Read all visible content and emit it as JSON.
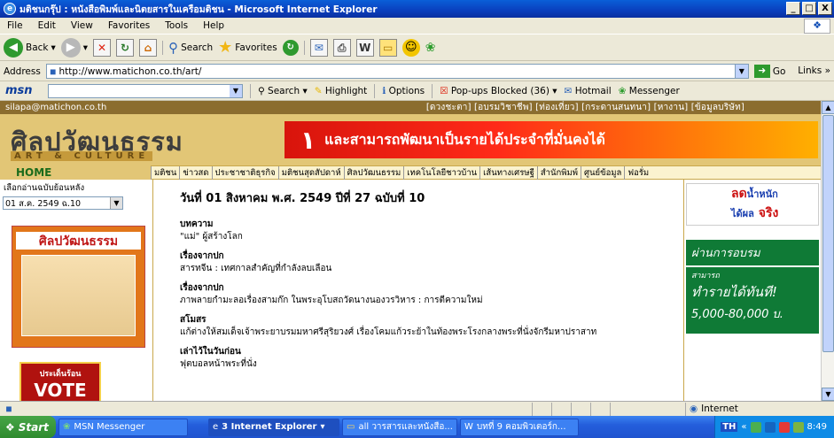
{
  "window": {
    "title": "มติชนกรุ๊ป : หนังสือพิมพ์และนิตยสารในเครือมติชน - Microsoft Internet Explorer",
    "controls": [
      "_",
      "ð",
      "X"
    ]
  },
  "menu": [
    "File",
    "Edit",
    "View",
    "Favorites",
    "Tools",
    "Help"
  ],
  "toolbar": {
    "back": "Back",
    "search": "Search",
    "favorites": "Favorites"
  },
  "address": {
    "label": "Address",
    "url": "http://www.matichon.co.th/art/",
    "go": "Go",
    "links": "Links"
  },
  "msnbar": {
    "brand": "msn",
    "search": "Search",
    "highlight": "Highlight",
    "options": "Options",
    "popups": "Pop-ups Blocked (36)",
    "hotmail": "Hotmail",
    "messenger": "Messenger"
  },
  "site": {
    "email": "silapa@matichon.co.th",
    "toplinks": "[ดวงชะตา] [อบรมวิชาชีพ] [ท่องเที่ยว] [กระดานสนทนา] [หางาน] [ข้อมูลบริษัท]",
    "logo": "ศิลปวัฒนธรรม",
    "logo_sub": "ART & CULTURE",
    "ad_text": "และสามารถพัฒนาเป็นรายได้ประจำที่มั่นคงได้",
    "home": "HOME",
    "nav": [
      "มติชน",
      "ข่าวสด",
      "ประชาชาติธุรกิจ",
      "มติชนสุดสัปดาห์",
      "ศิลปวัฒนธรรม",
      "เทคโนโลยีชาวบ้าน",
      "เส้นทางเศรษฐี",
      "สำนักพิมพ์",
      "ศูนย์ข้อมูล",
      "ฟอรั่ม"
    ],
    "back_issues_label": "เลือกอ่านฉบับย้อนหลัง",
    "issue_selected": "01 ส.ค. 2549 ฉ.10",
    "cover_title": "ศิลปวัฒนธรรม",
    "vote_top": "ประเด็นร้อน",
    "vote": "VOTE",
    "date": "วันที่ 01 สิงหาคม พ.ศ. 2549 ปีที่ 27 ฉบับที่ 10",
    "sections": [
      {
        "heading": "บทความ",
        "text": "\"แม่\" ผู้สร้างโลก"
      },
      {
        "heading": "เรื่องจากปก",
        "text": "สารทจีน : เทศกาลสำคัญที่กำลังลบเลือน"
      },
      {
        "heading": "เรื่องจากปก",
        "text": "ภาพลายกำมะลอเรื่องสามก๊ก ในพระอุโบสถวัดนางนองวรวิหาร : การตีความใหม่"
      },
      {
        "heading": "สโมสร",
        "text": "แก้ต่างให้สมเด็จเจ้าพระยาบรมมหาศรีสุริยวงศ์ เรื่องโคมแก้วระย้าในท้องพระโรงกลางพระที่นั่งจักรีมหาปราสาท"
      },
      {
        "heading": "เล่าไว้ในวันก่อน",
        "text": "ฟุตบอลหน้าพระที่นั่ง"
      }
    ],
    "ad_right1_a": "ลด",
    "ad_right1_b": "น้ำหนัก",
    "ad_right1_c": "ได้ผล",
    "ad_right1_d": "จริง",
    "ad_right2_head": "ผ่านการอบรม",
    "ad_right2_sub": "สามารถ",
    "ad_right2_big": "ทำรายได้ทันที!",
    "ad_right2_money": "5,000-80,000 บ."
  },
  "statusbar": {
    "zone": "Internet"
  },
  "taskbar": {
    "start": "Start",
    "tasks": [
      "MSN Messenger",
      "3 Internet Explorer",
      "all วารสารและหนังสือ...",
      "บทที่ 9 คอมพิวเตอร์ก..."
    ],
    "clock": "8:49",
    "tray_lang": "TH"
  }
}
